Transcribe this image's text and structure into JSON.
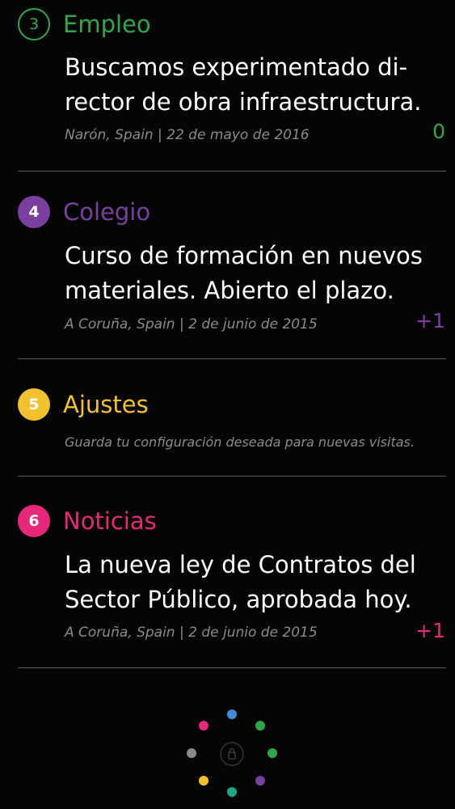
{
  "items": [
    {
      "number": "3",
      "category": "Empleo",
      "color": "#2ea84a",
      "headline_lines": [
        "Buscamos experimentado di-",
        "rector de obra infraestructura."
      ],
      "meta": "Narón, Spain | 22 de mayo de 2016",
      "count": "0"
    },
    {
      "number": "4",
      "category": "Colegio",
      "color": "#7b3fa0",
      "headline_lines": [
        "Curso de formación en nuevos",
        "materiales. Abierto el plazo."
      ],
      "meta": "A Coruña, Spain | 2 de junio de 2015",
      "count": "+1"
    },
    {
      "number": "5",
      "category": "Ajustes",
      "color": "#f2c12e",
      "description": "Guarda tu configuración deseada para nuevas visitas."
    },
    {
      "number": "6",
      "category": "Noticias",
      "color": "#e5287a",
      "headline_lines": [
        "La nueva ley de Contratos del",
        "Sector Público, aprobada hoy."
      ],
      "meta": "A Coruña, Spain | 2 de junio de 2015",
      "count": "+1"
    }
  ],
  "footer": {
    "dot_colors": {
      "top": "#3a8fd8",
      "top_right": "#2ea84a",
      "right": "#2ea84a",
      "bottom_right": "#7b3fa0",
      "bottom": "#1aa88a",
      "bottom_left": "#f2c12e",
      "left": "#8a8a8a",
      "top_left": "#e5287a"
    },
    "center_icon": "lock-icon"
  }
}
